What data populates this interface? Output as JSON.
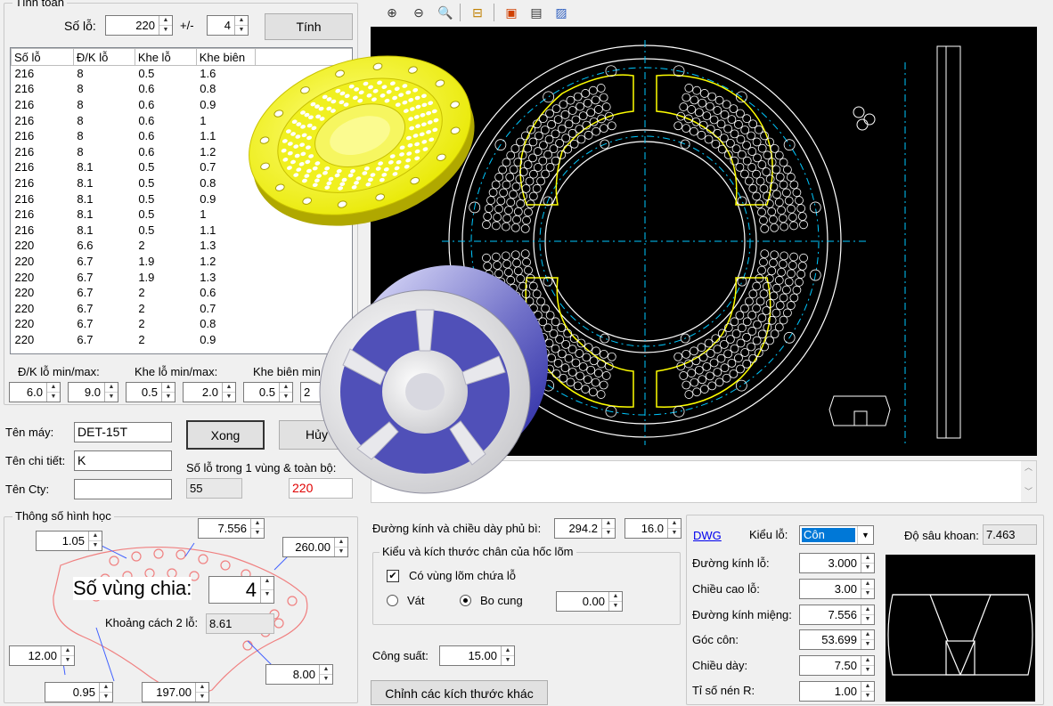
{
  "tinh_toan": {
    "group_title": "Tính toán",
    "so_lo_label": "Số lỗ:",
    "so_lo_value": "220",
    "tolerance_label": "+/-",
    "tolerance_value": "4",
    "calc_button": "Tính"
  },
  "table": {
    "headers": [
      "Số lỗ",
      "Đ/K lỗ",
      "Khe lỗ",
      "Khe biên"
    ],
    "rows": [
      [
        "216",
        "8",
        "0.5",
        "1.6"
      ],
      [
        "216",
        "8",
        "0.6",
        "0.8"
      ],
      [
        "216",
        "8",
        "0.6",
        "0.9"
      ],
      [
        "216",
        "8",
        "0.6",
        "1"
      ],
      [
        "216",
        "8",
        "0.6",
        "1.1"
      ],
      [
        "216",
        "8",
        "0.6",
        "1.2"
      ],
      [
        "216",
        "8.1",
        "0.5",
        "0.7"
      ],
      [
        "216",
        "8.1",
        "0.5",
        "0.8"
      ],
      [
        "216",
        "8.1",
        "0.5",
        "0.9"
      ],
      [
        "216",
        "8.1",
        "0.5",
        "1"
      ],
      [
        "216",
        "8.1",
        "0.5",
        "1.1"
      ],
      [
        "220",
        "6.6",
        "2",
        "1.3"
      ],
      [
        "220",
        "6.7",
        "1.9",
        "1.2"
      ],
      [
        "220",
        "6.7",
        "1.9",
        "1.3"
      ],
      [
        "220",
        "6.7",
        "2",
        "0.6"
      ],
      [
        "220",
        "6.7",
        "2",
        "0.7"
      ],
      [
        "220",
        "6.7",
        "2",
        "0.8"
      ],
      [
        "220",
        "6.7",
        "2",
        "0.9"
      ]
    ]
  },
  "ranges": {
    "dk_label": "Đ/K lỗ min/max:",
    "khe_lo_label": "Khe lỗ min/max:",
    "khe_bien_label": "Khe biên min",
    "dk_min": "6.0",
    "dk_max": "9.0",
    "khe_lo_min": "0.5",
    "khe_lo_max": "2.0",
    "khe_bien_min": "0.5",
    "khe_bien_max": "2"
  },
  "info": {
    "ten_may_label": "Tên máy:",
    "ten_may": "DET-15T",
    "ten_chi_tiet_label": "Tên chi tiết:",
    "ten_chi_tiet": "K",
    "ten_cty_label": "Tên Cty:",
    "ten_cty": "",
    "ok_button": "Xong",
    "cancel_button": "Hủy",
    "so_lo_vung_label": "Số lỗ trong 1 vùng & toàn bộ:",
    "so_lo_vung": "55",
    "so_lo_toan_bo": "220"
  },
  "hinh_hoc": {
    "group_title": "Thông số hình học",
    "v_1_05": "1.05",
    "v_7_556": "7.556",
    "v_260": "260.00",
    "so_vung_label": "Số vùng chia:",
    "so_vung": "4",
    "khoang_cach_label": "Khoảng cách 2 lỗ:",
    "khoang_cach": "8.61",
    "v_12": "12.00",
    "v_8": "8.00",
    "v_0_95": "0.95",
    "v_197": "197.00"
  },
  "phu_bi": {
    "label": "Đường kính và chiều dày phủ bì:",
    "duong_kinh": "294.2",
    "chieu_day": "16.0"
  },
  "chan_hoc": {
    "group_title": "Kiểu và kích thước chân của hốc lõm",
    "checkbox_label": "Có vùng lõm chứa lỗ",
    "checked": "✔",
    "radio_vat": "Vát",
    "radio_bo_cung": "Bo cung",
    "value": "0.00"
  },
  "cong_suat": {
    "label": "Công suất:",
    "value": "15.00"
  },
  "other_button": "Chỉnh các kích thước khác",
  "right_panel": {
    "dwg_link": "DWG",
    "kieu_lo_label": "Kiểu lỗ:",
    "kieu_lo": "Côn",
    "do_sau_label": "Độ sâu khoan:",
    "do_sau": "7.463",
    "duong_kinh_lo_label": "Đường kính lỗ:",
    "duong_kinh_lo": "3.000",
    "chieu_cao_lo_label": "Chiều cao lỗ:",
    "chieu_cao_lo": "3.00",
    "duong_kinh_mieng_label": "Đường kính miệng:",
    "duong_kinh_mieng": "7.556",
    "goc_con_label": "Góc côn:",
    "goc_con": "53.699",
    "chieu_day_label": "Chiều dày:",
    "chieu_day": "7.50",
    "ti_so_label": "Tỉ số nén R:",
    "ti_so": "1.00"
  },
  "toolbar_icons": [
    "zoom-in-icon",
    "zoom-out-icon",
    "zoom-window-icon",
    "measure-icon",
    "export-dxf-icon",
    "save-icon",
    "image-icon"
  ],
  "colors": {
    "cad_bg": "#000000",
    "cad_yellow": "#ffff00",
    "cad_cyan": "#00c8ff",
    "red_value": "#e00000",
    "link": "#0000ee"
  }
}
